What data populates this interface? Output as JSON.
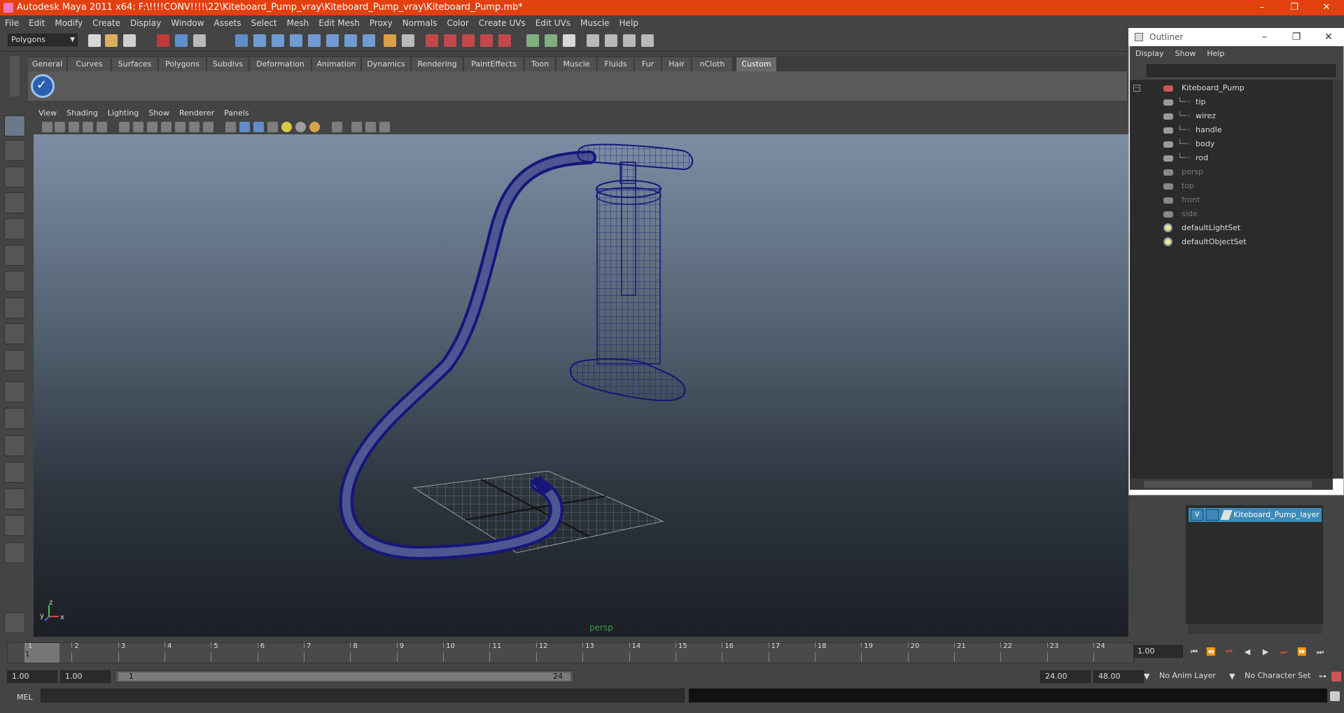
{
  "window": {
    "title": "Autodesk Maya 2011 x64: F:\\!!!!CONV!!!!\\22\\Kiteboard_Pump_vray\\Kiteboard_Pump_vray\\Kiteboard_Pump.mb*",
    "minimize": "–",
    "maximize": "❐",
    "close": "✕"
  },
  "menubar": [
    "File",
    "Edit",
    "Modify",
    "Create",
    "Display",
    "Window",
    "Assets",
    "Select",
    "Mesh",
    "Edit Mesh",
    "Proxy",
    "Normals",
    "Color",
    "Create UVs",
    "Edit UVs",
    "Muscle",
    "Help"
  ],
  "status_line": {
    "mode": "Polygons"
  },
  "shelf": {
    "tabs": [
      "General",
      "Curves",
      "Surfaces",
      "Polygons",
      "Subdivs",
      "Deformation",
      "Animation",
      "Dynamics",
      "Rendering",
      "PaintEffects",
      "Toon",
      "Muscle",
      "Fluids",
      "Fur",
      "Hair",
      "nCloth",
      "Custom"
    ],
    "active_tab": "Custom"
  },
  "viewport": {
    "menu": [
      "View",
      "Shading",
      "Lighting",
      "Show",
      "Renderer",
      "Panels"
    ],
    "camera_label": "persp",
    "axis_x": "x",
    "axis_y": "y",
    "axis_z": "z"
  },
  "outliner": {
    "title": "Outliner",
    "menu": [
      "Display",
      "Show",
      "Help"
    ],
    "items": [
      {
        "label": "Kiteboard_Pump",
        "indent": 0,
        "dim": false,
        "icon": "transform-icon"
      },
      {
        "label": "tip",
        "indent": 1,
        "dim": false,
        "icon": "mesh-icon"
      },
      {
        "label": "wirez",
        "indent": 1,
        "dim": false,
        "icon": "mesh-icon"
      },
      {
        "label": "handle",
        "indent": 1,
        "dim": false,
        "icon": "mesh-icon"
      },
      {
        "label": "body",
        "indent": 1,
        "dim": false,
        "icon": "mesh-icon"
      },
      {
        "label": "rod",
        "indent": 1,
        "dim": false,
        "icon": "mesh-icon"
      },
      {
        "label": "persp",
        "indent": 0,
        "dim": true,
        "icon": "camera-icon"
      },
      {
        "label": "top",
        "indent": 0,
        "dim": true,
        "icon": "camera-icon"
      },
      {
        "label": "front",
        "indent": 0,
        "dim": true,
        "icon": "camera-icon"
      },
      {
        "label": "side",
        "indent": 0,
        "dim": true,
        "icon": "camera-icon"
      },
      {
        "label": "defaultLightSet",
        "indent": 0,
        "dim": false,
        "icon": "set-icon"
      },
      {
        "label": "defaultObjectSet",
        "indent": 0,
        "dim": false,
        "icon": "set-icon"
      }
    ]
  },
  "layers": {
    "items": [
      {
        "visible": "V",
        "name": "Kiteboard_Pump_layer"
      }
    ]
  },
  "timeline": {
    "ticks": [
      "1",
      "2",
      "3",
      "4",
      "5",
      "6",
      "7",
      "8",
      "9",
      "10",
      "11",
      "12",
      "13",
      "14",
      "15",
      "16",
      "17",
      "18",
      "19",
      "20",
      "21",
      "22",
      "23",
      "24"
    ],
    "current_frame": "1.00",
    "frame_label": "1"
  },
  "range": {
    "start": "1.00",
    "inner_start": "1.00",
    "slider_start": "1",
    "slider_end": "24",
    "end": "24.00",
    "outer_end": "48.00",
    "anim_layer": "No Anim Layer",
    "character_set": "No Character Set"
  },
  "command_line": {
    "lang": "MEL"
  },
  "colors": {
    "title_bar": "#e2400f",
    "wireframe": "#16167a",
    "layer_highlight": "#3d8ab8"
  }
}
